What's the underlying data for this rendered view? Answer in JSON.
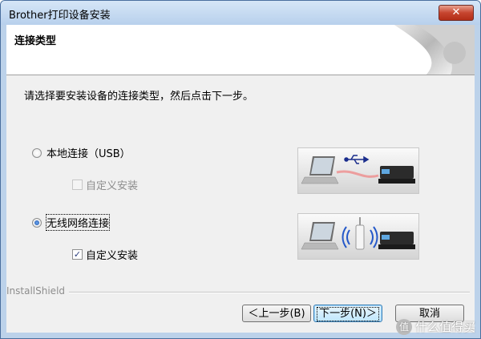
{
  "window": {
    "title": "Brother打印设备安装",
    "close_label": "✕"
  },
  "header": {
    "title": "连接类型"
  },
  "instruction": "请选择要安装设备的连接类型，然后点击下一步。",
  "options": [
    {
      "label": "本地连接（USB）",
      "selected": false,
      "custom_install_label": "自定义安装",
      "custom_install_checked": false,
      "custom_install_enabled": false,
      "illustration": "usb-connection"
    },
    {
      "label": "无线网络连接",
      "selected": true,
      "custom_install_label": "自定义安装",
      "custom_install_checked": true,
      "custom_install_enabled": true,
      "illustration": "wireless-connection"
    }
  ],
  "footer": {
    "installshield_label": "InstallShield",
    "back_label": "＜上一步(B)",
    "next_label": "下一步(N)＞",
    "cancel_label": "取消"
  },
  "watermark": {
    "badge": "值",
    "text": "什么值得买"
  }
}
